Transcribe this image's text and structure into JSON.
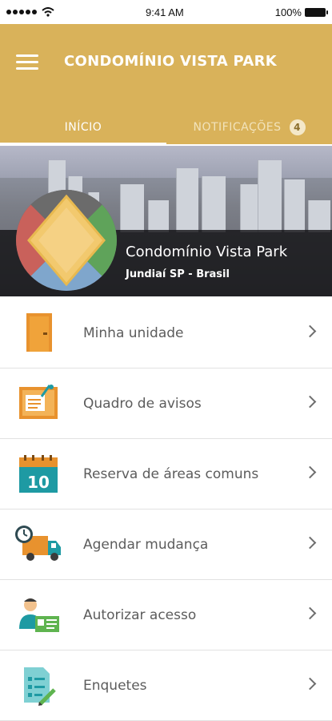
{
  "status_bar": {
    "time": "9:41 AM",
    "battery": "100%",
    "icons": [
      "signal-dots-icon",
      "wifi-icon",
      "battery-icon"
    ]
  },
  "header": {
    "title": "CONDOMÍNIO VISTA PARK",
    "menu_icon": "hamburger-menu-icon",
    "background": "#d9b25a"
  },
  "tabs": [
    {
      "label": "INÍCIO",
      "active": true
    },
    {
      "label": "NOTIFICAÇÕES",
      "badge": "4",
      "active": false
    }
  ],
  "hero": {
    "name": "Condomínio Vista Park",
    "location": "Jundiaí SP - Brasil"
  },
  "menu": {
    "items": [
      {
        "label": "Minha unidade",
        "icon": "door-icon"
      },
      {
        "label": "Quadro de avisos",
        "icon": "notice-board-icon"
      },
      {
        "label": "Reserva de áreas comuns",
        "icon": "calendar-icon",
        "icon_text": "10"
      },
      {
        "label": "Agendar mudança",
        "icon": "moving-truck-icon"
      },
      {
        "label": "Autorizar acesso",
        "icon": "access-card-icon"
      },
      {
        "label": "Enquetes",
        "icon": "survey-icon"
      }
    ]
  }
}
